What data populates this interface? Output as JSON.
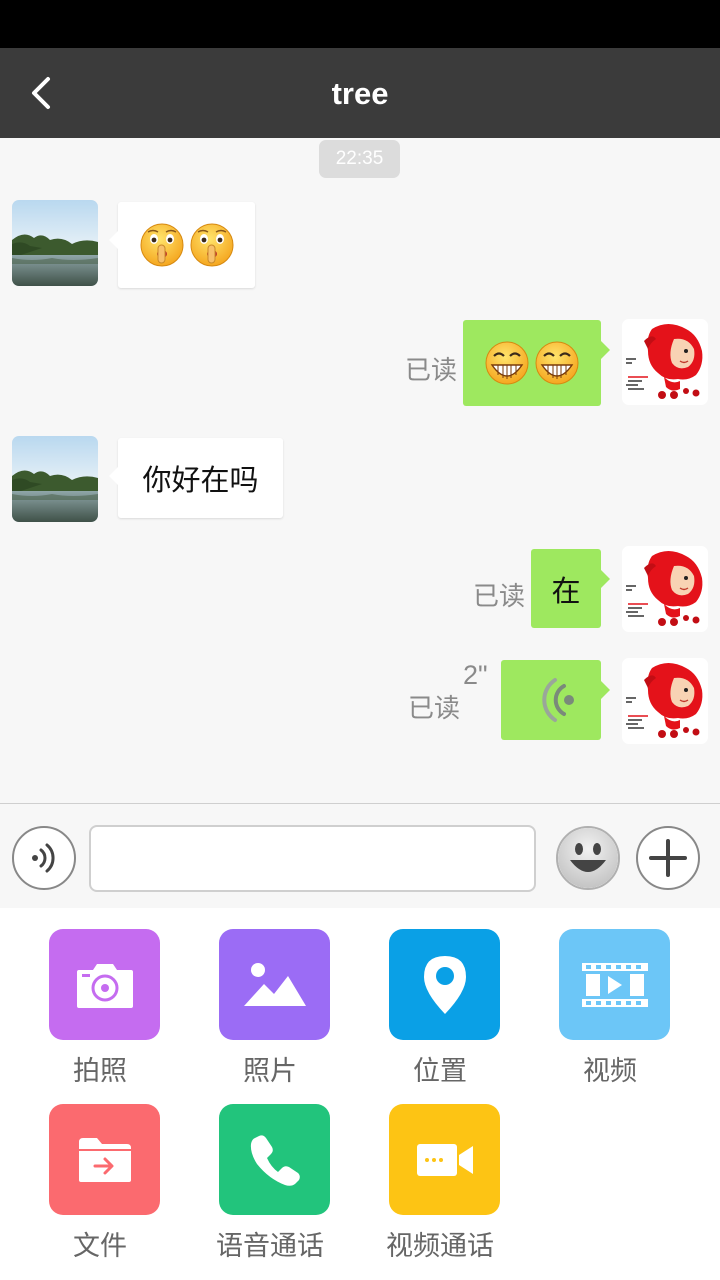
{
  "header": {
    "title": "tree"
  },
  "chat": {
    "timestamp": "22:35",
    "messages": [
      {
        "side": "in",
        "type": "emoji",
        "emojis": [
          "shush-emoji",
          "shush-emoji"
        ]
      },
      {
        "side": "out",
        "type": "emoji",
        "emojis": [
          "grin-emoji",
          "grin-emoji"
        ],
        "status": "已读"
      },
      {
        "side": "in",
        "type": "text",
        "text": "你好在吗"
      },
      {
        "side": "out",
        "type": "text",
        "text": "在",
        "status": "已读"
      },
      {
        "side": "out",
        "type": "voice",
        "duration": "2\"",
        "status": "已读"
      }
    ]
  },
  "input": {
    "value": "",
    "placeholder": ""
  },
  "tools": [
    {
      "label": "拍照",
      "icon": "camera-icon",
      "color": "#c56cf0"
    },
    {
      "label": "照片",
      "icon": "picture-icon",
      "color": "#9b6cf5"
    },
    {
      "label": "位置",
      "icon": "location-pin-icon",
      "color": "#0aa0e6"
    },
    {
      "label": "视频",
      "icon": "film-icon",
      "color": "#6cc6f7"
    },
    {
      "label": "文件",
      "icon": "folder-icon",
      "color": "#fb6a6f"
    },
    {
      "label": "语音通话",
      "icon": "phone-icon",
      "color": "#22c47c"
    },
    {
      "label": "视频通话",
      "icon": "video-camera-icon",
      "color": "#fdc414"
    }
  ],
  "colors": {
    "titlebar": "#3b3b3b",
    "outgoing_bubble": "#9ee85f",
    "incoming_bubble": "#ffffff",
    "chat_background": "#f7f7f7"
  }
}
